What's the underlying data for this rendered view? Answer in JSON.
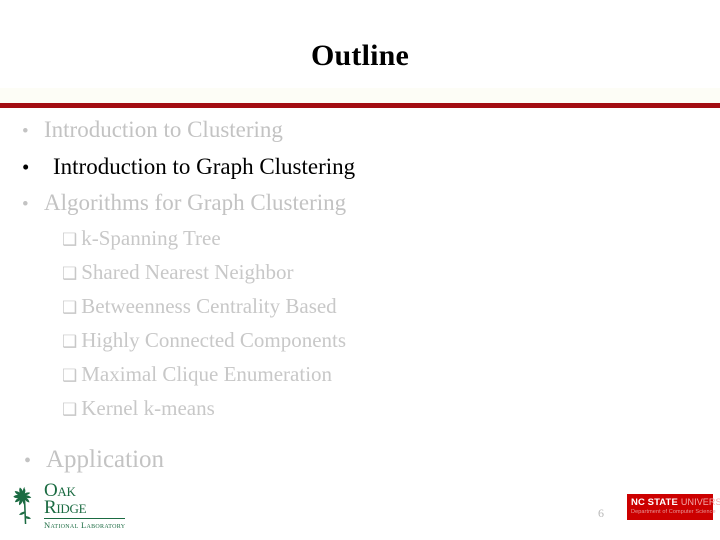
{
  "slide": {
    "title": "Outline",
    "page_number": "6",
    "accent_color": "#a30d12",
    "dim_text_color": "#c3c3c3",
    "active_text_color": "#000000"
  },
  "outline": {
    "bullet_marker": "•",
    "checkbox_marker": "❑",
    "items": [
      {
        "level": 1,
        "label": "Introduction to Clustering",
        "state": "dim"
      },
      {
        "level": 1,
        "label": "Introduction to Graph Clustering",
        "state": "current"
      },
      {
        "level": 1,
        "label": "Algorithms for Graph Clustering",
        "state": "dim"
      },
      {
        "level": 2,
        "label": "k-Spanning Tree",
        "state": "dim"
      },
      {
        "level": 2,
        "label": "Shared Nearest Neighbor",
        "state": "dim"
      },
      {
        "level": 2,
        "label": "Betweenness Centrality Based",
        "state": "dim"
      },
      {
        "level": 2,
        "label": "Highly Connected Components",
        "state": "dim"
      },
      {
        "level": 2,
        "label": "Maximal Clique Enumeration",
        "state": "dim"
      },
      {
        "level": 2,
        "label": "Kernel k-means",
        "state": "dim"
      },
      {
        "level": 1,
        "label": "Application",
        "state": "dim"
      }
    ]
  },
  "footer": {
    "ornl_logo": {
      "line1": "Oak",
      "line2": "Ridge",
      "line3": "National Laboratory",
      "color": "#1b6b42"
    },
    "ncsu_logo": {
      "line1_bold": "NC STATE",
      "line1_light": "UNIVERSITY",
      "line2": "Department of Computer Science",
      "color": "#cc0000"
    }
  }
}
